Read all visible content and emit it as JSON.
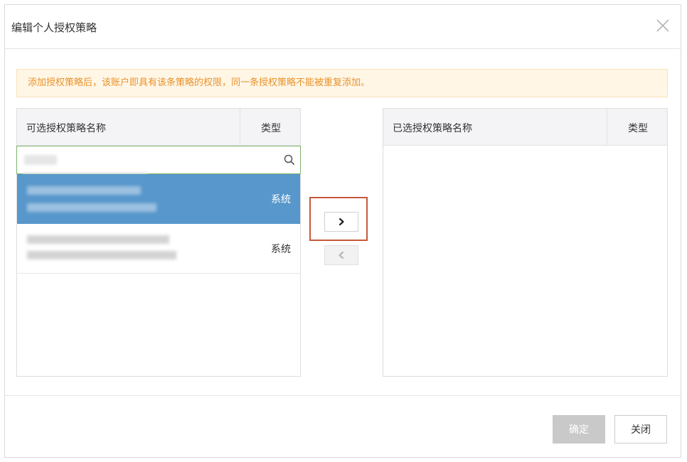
{
  "dialog": {
    "title": "编辑个人授权策略",
    "close_icon": "close-icon"
  },
  "alert": {
    "message": "添加授权策略后，该账户即具有该条策略的权限，同一条授权策略不能被重复添加。",
    "color": "#e8932b"
  },
  "available": {
    "header_name": "可选授权策略名称",
    "header_type": "类型",
    "search": {
      "value": "",
      "placeholder": "",
      "icon": "search-icon"
    },
    "rows": [
      {
        "type": "系统",
        "selected": true
      },
      {
        "type": "系统",
        "selected": false
      }
    ]
  },
  "selected_list": {
    "header_name": "已选授权策略名称",
    "header_type": "类型"
  },
  "transfer": {
    "add_icon": "chevron-right-icon",
    "remove_icon": "chevron-left-icon"
  },
  "footer": {
    "confirm_label": "确定",
    "close_label": "关闭"
  },
  "colors": {
    "selected_row": "#5797cb",
    "highlight": "#c4593b",
    "search_border": "#7cb36b"
  }
}
